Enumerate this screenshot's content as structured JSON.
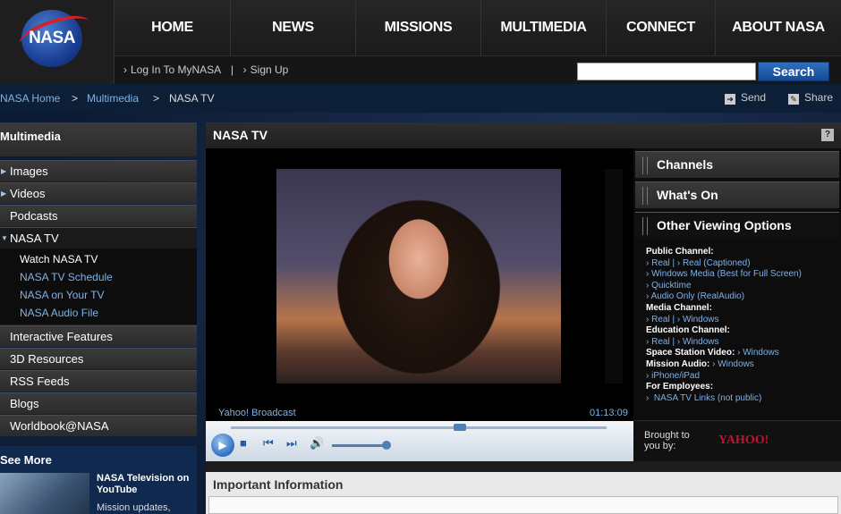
{
  "header": {
    "logo_text": "NASA",
    "nav": [
      "HOME",
      "NEWS",
      "MISSIONS",
      "MULTIMEDIA",
      "CONNECT",
      "ABOUT NASA"
    ],
    "login_label": "Log In To MyNASA",
    "signup_label": "Sign Up",
    "search_value": "",
    "search_button": "Search"
  },
  "breadcrumb": {
    "home": "NASA Home",
    "multimedia": "Multimedia",
    "current": "NASA TV",
    "separator": ">",
    "send": "Send",
    "share": "Share"
  },
  "sidebar": {
    "title": "Multimedia",
    "items": {
      "images": "Images",
      "videos": "Videos",
      "podcasts": "Podcasts",
      "nasa_tv": "NASA TV",
      "interactive": "Interactive Features",
      "resources_3d": "3D Resources",
      "rss": "RSS Feeds",
      "blogs": "Blogs",
      "worldbook": "Worldbook@NASA"
    },
    "subitems": [
      "Watch NASA TV",
      "NASA TV Schedule",
      "NASA on Your TV",
      "NASA Audio File"
    ],
    "see_more": {
      "title": "See More",
      "item_title": "NASA Television on YouTube",
      "item_text": "Mission updates,"
    }
  },
  "main": {
    "title": "NASA TV",
    "help": "?",
    "player": {
      "label": "Yahoo! Broadcast",
      "time": "01:13:09"
    },
    "accordion": [
      "Channels",
      "What's On",
      "Other Viewing Options"
    ],
    "options": {
      "public_head": "Public Channel:",
      "public_real": "Real",
      "public_real_captioned": "Real (Captioned)",
      "public_wm": "Windows Media (Best for Full Screen)",
      "public_qt": "Quicktime",
      "public_audio": "Audio Only (RealAudio)",
      "media_head": "Media Channel:",
      "media_real": "Real",
      "media_windows": "Windows",
      "edu_head": "Education Channel:",
      "edu_real": "Real",
      "edu_windows": "Windows",
      "ss_head": "Space Station Video:",
      "ss_windows": "Windows",
      "mission_head": "Mission Audio:",
      "mission_windows": "Windows",
      "iphone": "iPhone/iPad",
      "employees_head": "For Employees:",
      "employees_link": "NASA TV Links (not public)"
    },
    "sponsor": {
      "text": "Brought to you by:",
      "logo": "YAHOO!"
    },
    "info_title": "Important Information"
  },
  "colors": {
    "accent_blue": "#2f6fc0",
    "link": "#7fb2e8",
    "yahoo_red": "#c8102e"
  }
}
